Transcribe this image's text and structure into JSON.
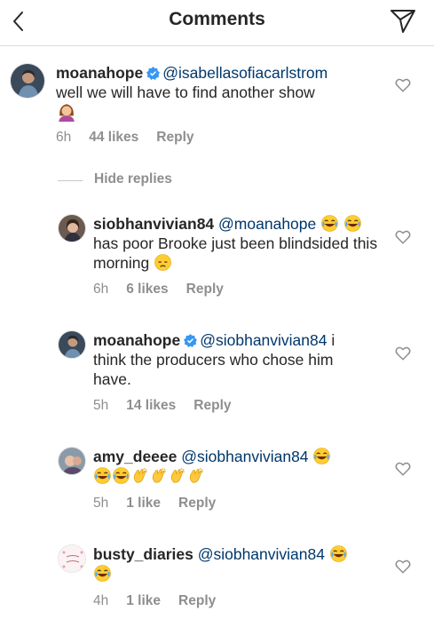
{
  "header": {
    "title": "Comments"
  },
  "hide_replies_label": "Hide replies",
  "comments": [
    {
      "username": "moanahope",
      "verified": true,
      "mention": "@isabellasofiacarlstrom",
      "text": "well we will have to find another show",
      "time": "6h",
      "likes": "44 likes",
      "reply": "Reply"
    },
    {
      "username": "siobhanvivian84",
      "verified": false,
      "mention": "@moanahope",
      "text": "has poor Brooke just been blindsided this morning",
      "time": "6h",
      "likes": "6 likes",
      "reply": "Reply"
    },
    {
      "username": "moanahope",
      "verified": true,
      "mention": "@siobhanvivian84",
      "text": "i think the producers who chose him have.",
      "time": "5h",
      "likes": "14 likes",
      "reply": "Reply"
    },
    {
      "username": "amy_deeee",
      "verified": false,
      "mention": "@siobhanvivian84",
      "text": "",
      "time": "5h",
      "likes": "1 like",
      "reply": "Reply"
    },
    {
      "username": "busty_diaries",
      "verified": false,
      "mention": "@siobhanvivian84",
      "text": "",
      "time": "4h",
      "likes": "1 like",
      "reply": "Reply"
    }
  ],
  "colors": {
    "text": "#262626",
    "mention": "#00376b",
    "secondary": "#8e8e8e",
    "verified": "#3897f0",
    "divider": "#dbdbdb"
  }
}
